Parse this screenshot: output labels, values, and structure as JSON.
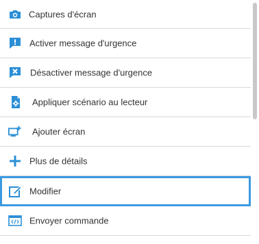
{
  "colors": {
    "icon": "#2b8fd6",
    "text": "#333333",
    "divider": "#d8d8d8",
    "selection_border": "#3b9ae1",
    "scrollbar": "#c8c8c8"
  },
  "menu": {
    "items": [
      {
        "label": "Captures d'écran",
        "icon": "camera-icon"
      },
      {
        "label": "Activer message d'urgence",
        "icon": "alert-message-icon"
      },
      {
        "label": "Désactiver message d'urgence",
        "icon": "clear-message-icon"
      },
      {
        "label": "Appliquer scénario au lecteur",
        "icon": "scenario-settings-icon"
      },
      {
        "label": "Ajouter écran",
        "icon": "add-screen-icon"
      },
      {
        "label": "Plus de détails",
        "icon": "plus-icon"
      },
      {
        "label": "Modifier",
        "icon": "edit-icon",
        "selected": true
      },
      {
        "label": "Envoyer commande",
        "icon": "command-icon"
      }
    ]
  }
}
